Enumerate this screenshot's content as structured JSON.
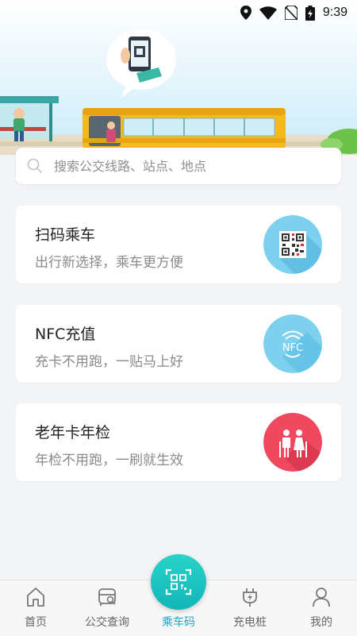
{
  "status_bar": {
    "time": "9:39",
    "icons": [
      "location-icon",
      "wifi-icon",
      "no-sim-icon",
      "battery-icon"
    ]
  },
  "search": {
    "placeholder": "搜索公交线路、站点、地点"
  },
  "cards": [
    {
      "title": "扫码乘车",
      "subtitle": "出行新选择，乘车更方便",
      "icon": "qr-code-icon",
      "color": "#7ed0ef"
    },
    {
      "title": "NFC充值",
      "subtitle": "充卡不用跑，一贴马上好",
      "icon": "nfc-icon",
      "badge_text": "NFC",
      "color": "#7ed0ef"
    },
    {
      "title": "老年卡年检",
      "subtitle": "年检不用跑，一刷就生效",
      "icon": "elderly-icon",
      "color": "#f0485e"
    }
  ],
  "tabbar": {
    "items": [
      {
        "label": "首页",
        "icon": "home-icon"
      },
      {
        "label": "公交查询",
        "icon": "bus-search-icon"
      },
      {
        "label": "乘车码",
        "icon": "scan-icon",
        "active": true
      },
      {
        "label": "充电桩",
        "icon": "charging-icon"
      },
      {
        "label": "我的",
        "icon": "user-icon"
      }
    ],
    "active_color": "#1aa8c6"
  }
}
